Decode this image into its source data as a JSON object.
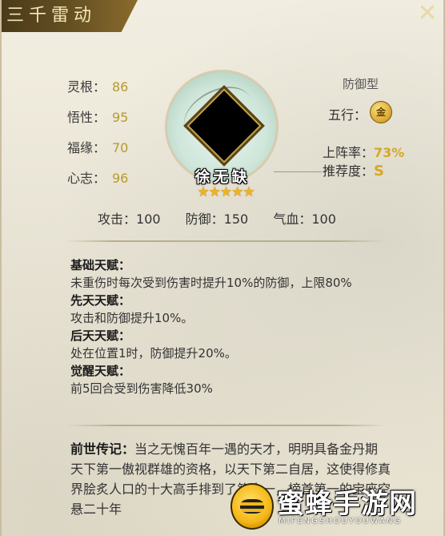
{
  "header": {
    "title": "三千雷动",
    "close_icon": "close-icon"
  },
  "attributes": [
    {
      "label": "灵根：",
      "value": "86"
    },
    {
      "label": "悟性：",
      "value": "95"
    },
    {
      "label": "福缘：",
      "value": "70"
    },
    {
      "label": "心志：",
      "value": "96"
    }
  ],
  "hero": {
    "name": "徐无缺",
    "stars": "★★★★★",
    "star_count": 5
  },
  "info": {
    "type": "防御型",
    "wuxing_label": "五行：",
    "wuxing_value": "金",
    "rate_label": "上阵率：",
    "rate_value": "73%",
    "rec_label": "推荐度：",
    "rec_value": "S"
  },
  "combat": [
    {
      "label": "攻击：",
      "value": "100"
    },
    {
      "label": "防御：",
      "value": "150"
    },
    {
      "label": "气血：",
      "value": "100"
    }
  ],
  "talents": [
    {
      "title": "基础天赋：",
      "text": "未重伤时每次受到伤害时提升10%的防御，上限80%"
    },
    {
      "title": "先天天赋：",
      "text": "攻击和防御提升10%。"
    },
    {
      "title": "后天天赋：",
      "text": "处在位置1时，防御提升20%。"
    },
    {
      "title": "觉醒天赋：",
      "text": "前5回合受到伤害降低30%"
    }
  ],
  "bio": {
    "title": "前世传记：",
    "text": "当之无愧百年一遇的天才，明明具备金丹期天下第一傲视群雄的资格，以天下第二自居，这使得修真界脍炙人口的十大高手排到了第十一，榜首第一的宝座空悬二十年"
  },
  "watermark": {
    "name": "蜜蜂手游网",
    "sub": "MIFENGSHOUYOUWANG"
  }
}
